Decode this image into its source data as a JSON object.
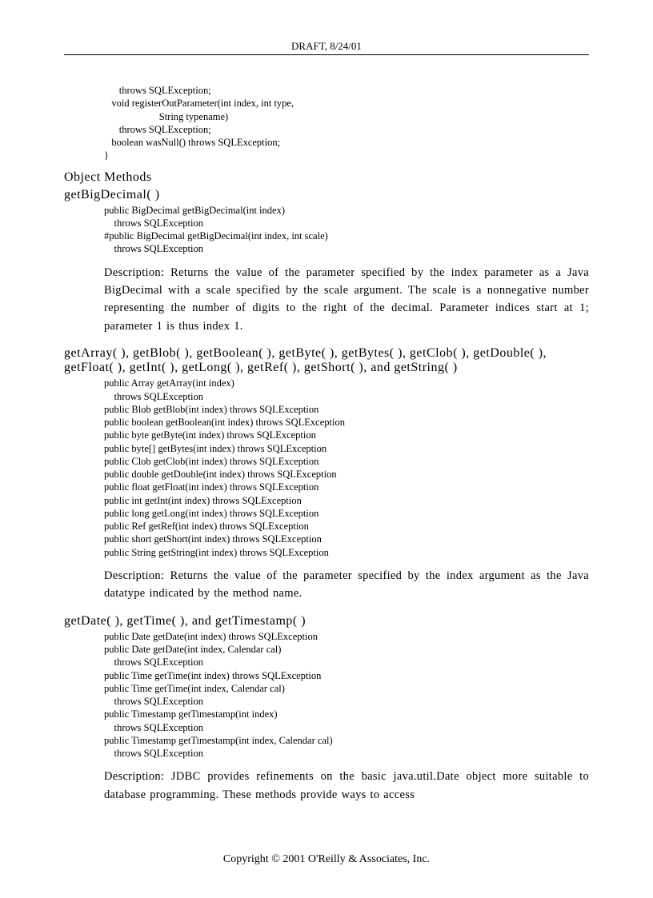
{
  "header": "DRAFT, 8/24/01",
  "codeIntro": "      throws SQLException;\n   void registerOutParameter(int index, int type,\n                      String typename)\n      throws SQLException;\n   boolean wasNull() throws SQLException;\n}",
  "sections": {
    "objectMethods": "Object Methods",
    "getBigDecimal": {
      "title": "getBigDecimal( )",
      "code": "public BigDecimal getBigDecimal(int index)\n    throws SQLException\n#public BigDecimal getBigDecimal(int index, int scale)\n    throws SQLException",
      "desc": "Description: Returns the value of the parameter specified by the index parameter as a Java BigDecimal with a scale specified by the scale argument. The scale is a nonnegative number representing the number of digits to the right of the decimal. Parameter indices start at 1; parameter 1 is thus index 1."
    },
    "getArray": {
      "title": "getArray( ), getBlob( ), getBoolean( ), getByte( ), getBytes( ), getClob( ), getDouble( ), getFloat( ), getInt( ), getLong( ), getRef( ), getShort( ), and getString( )",
      "code": "public Array getArray(int index)\n    throws SQLException\npublic Blob getBlob(int index) throws SQLException\npublic boolean getBoolean(int index) throws SQLException\npublic byte getByte(int index) throws SQLException\npublic byte[] getBytes(int index) throws SQLException\npublic Clob getClob(int index) throws SQLException\npublic double getDouble(int index) throws SQLException\npublic float getFloat(int index) throws SQLException\npublic int getInt(int index) throws SQLException\npublic long getLong(int index) throws SQLException\npublic Ref getRef(int index) throws SQLException\npublic short getShort(int index) throws SQLException\npublic String getString(int index) throws SQLException",
      "desc": "Description: Returns the value of the parameter specified by the index argument as the Java datatype indicated by the method name."
    },
    "getDate": {
      "title": "getDate( ), getTime( ), and getTimestamp( )",
      "code": "public Date getDate(int index) throws SQLException\npublic Date getDate(int index, Calendar cal)\n    throws SQLException\npublic Time getTime(int index) throws SQLException\npublic Time getTime(int index, Calendar cal)\n    throws SQLException\npublic Timestamp getTimestamp(int index)\n    throws SQLException\npublic Timestamp getTimestamp(int index, Calendar cal)\n    throws SQLException",
      "desc": "Description: JDBC provides refinements on the basic java.util.Date object more suitable to database programming.  These methods provide ways to access"
    }
  },
  "footer": "Copyright © 2001 O'Reilly & Associates, Inc."
}
